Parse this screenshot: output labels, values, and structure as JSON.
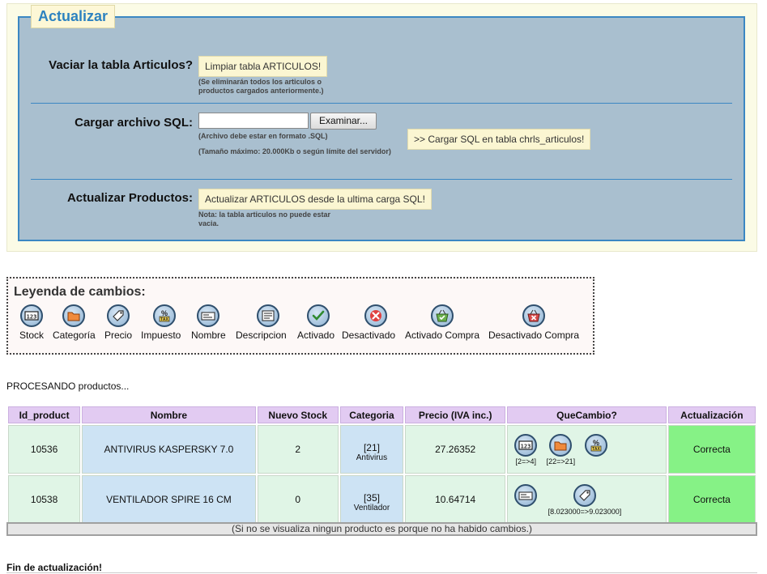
{
  "actualizar": {
    "title": "Actualizar",
    "vaciar_label": "Vaciar la tabla Articulos?",
    "vaciar_button": "Limpiar tabla ARTICULOS!",
    "vaciar_note_1": "(Se eliminarán todos los articulos o",
    "vaciar_note_2": "productos cargados anteriormente.)",
    "cargar_label": "Cargar archivo SQL:",
    "browse_button": "Examinar...",
    "cargar_note_1": "(Archivo debe estar en formato .SQL)",
    "cargar_note_2": "(Tamaño máximo: 20.000Kb o según límite del servidor)",
    "cargar_button": ">> Cargar SQL en tabla chrls_articulos!",
    "actualizar_label": "Actualizar Productos:",
    "actualizar_button": "Actualizar ARTICULOS desde la ultima carga SQL!",
    "actualizar_note_1": "Nota: la tabla articulos no puede estar",
    "actualizar_note_2": "vacia."
  },
  "leyenda": {
    "title": "Leyenda de cambios:",
    "items": [
      {
        "label": "Stock",
        "icon": "stock-123-icon"
      },
      {
        "label": "Categoría",
        "icon": "folder-icon"
      },
      {
        "label": "Precio",
        "icon": "price-tag-icon"
      },
      {
        "label": "Impuesto",
        "icon": "percent-tax-icon"
      },
      {
        "label": "Nombre",
        "icon": "name-card-icon"
      },
      {
        "label": "Descripcion",
        "icon": "description-icon"
      },
      {
        "label": "Activado",
        "icon": "check-icon"
      },
      {
        "label": "Desactivado",
        "icon": "x-icon"
      },
      {
        "label": "Activado Compra",
        "icon": "basket-check-icon"
      },
      {
        "label": "Desactivado Compra",
        "icon": "basket-x-icon"
      }
    ]
  },
  "processing_text": "PROCESANDO productos...",
  "table": {
    "headers": [
      "Id_product",
      "Nombre",
      "Nuevo Stock",
      "Categoria",
      "Precio (IVA inc.)",
      "QueCambio?",
      "Actualización"
    ],
    "rows": [
      {
        "id": "10536",
        "nombre": "ANTIVIRUS KASPERSKY 7.0",
        "stock": "2",
        "cat_id": "[21]",
        "cat_name": "Antivirus",
        "precio": "27.26352",
        "stock_change": "[2=>4]",
        "cat_change": "[22=>21]",
        "estado": "Correcta"
      },
      {
        "id": "10538",
        "nombre": "VENTILADOR SPIRE 16 CM",
        "stock": "0",
        "cat_id": "[35]",
        "cat_name": "Ventilador",
        "precio": "10.64714",
        "price_change": "[8.023000=>9.023000]",
        "estado": "Correcta"
      }
    ],
    "footer": "(Si no se visualiza ningun producto es porque no ha habido cambios.)"
  },
  "fin_text": "Fin de actualización!"
}
